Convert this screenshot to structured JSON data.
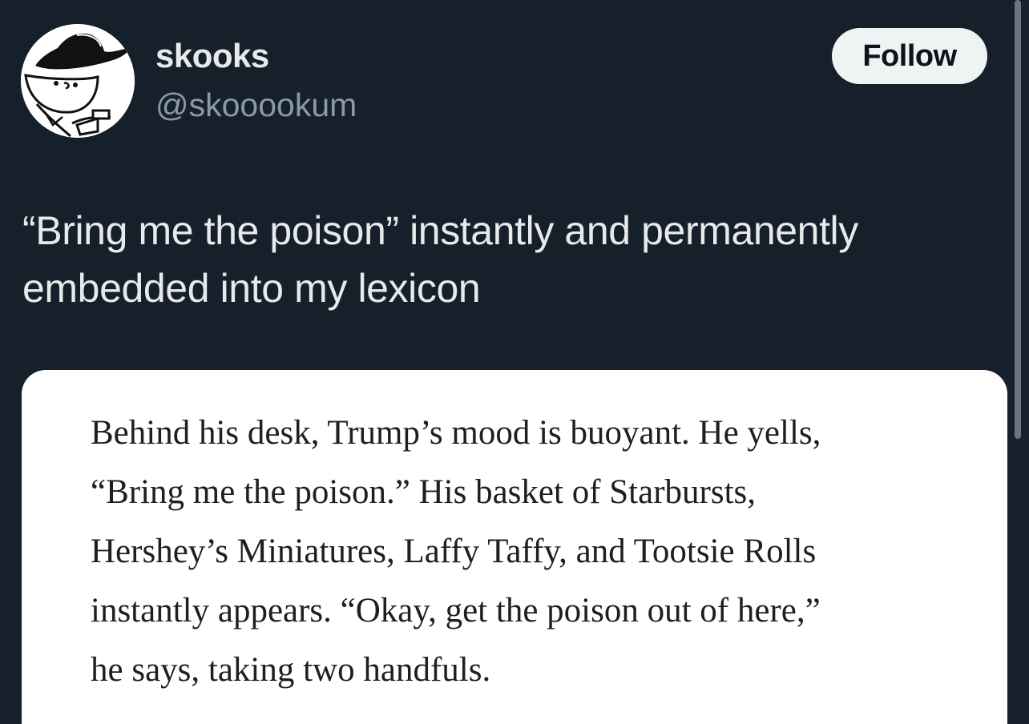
{
  "user": {
    "display_name": "skooks",
    "handle": "@skooookum",
    "avatar_icon": "cartoon-cowboy-avatar"
  },
  "follow_button": {
    "label": "Follow"
  },
  "tweet": {
    "text_lines": [
      "“Bring me the poison” instantly and permanently",
      "embedded into my lexicon"
    ]
  },
  "media": {
    "book_excerpt_lines": [
      "Behind his desk, Trump’s mood is buoyant. He yells,",
      "“Bring me the poison.” His basket of Starbursts,",
      "Hershey’s Miniatures, Laffy Taffy, and Tootsie Rolls",
      "instantly appears. “Okay, get the poison out of here,”",
      "he says, taking two handfuls."
    ]
  },
  "colors": {
    "background": "#15202b",
    "primary_text": "#e7e9ea",
    "secondary_text": "#8b98a5",
    "follow_button_bg": "#eff3f4",
    "follow_button_text": "#0f1419"
  }
}
